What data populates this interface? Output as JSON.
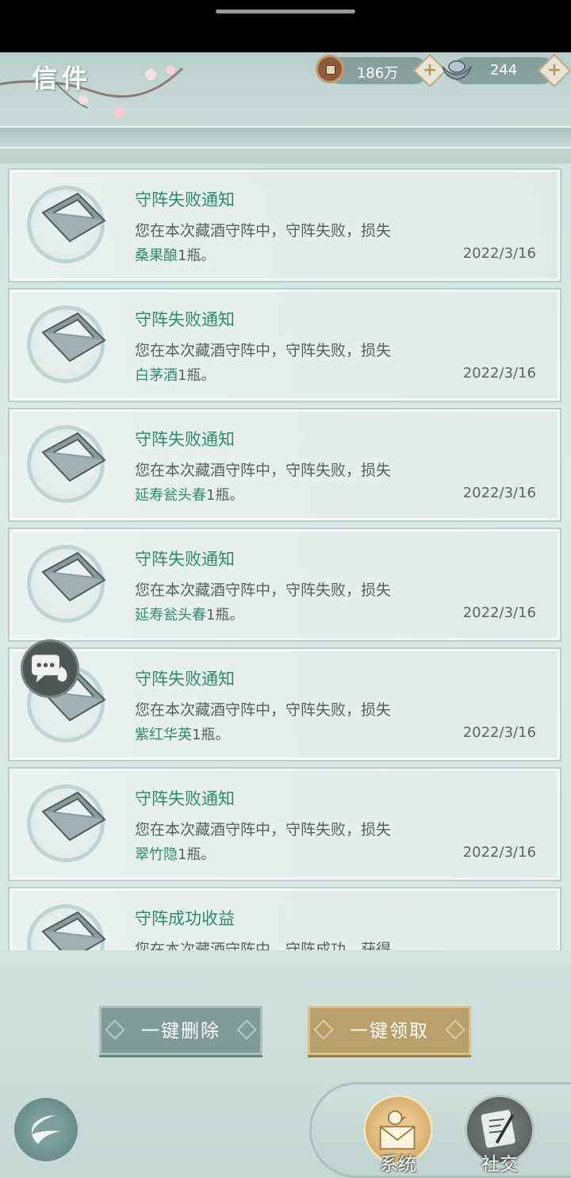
{
  "header": {
    "title": "信件",
    "copper": {
      "icon": "copper-coin-icon",
      "value": "186万",
      "add_label": "+"
    },
    "silver": {
      "icon": "silver-ingot-icon",
      "value": "244",
      "add_label": "+"
    }
  },
  "mails": [
    {
      "title": "守阵失败通知",
      "body": "您在本次藏酒守阵中，守阵失败，损失",
      "item": "桑果酿",
      "suffix": "1瓶。",
      "date": "2022/3/16"
    },
    {
      "title": "守阵失败通知",
      "body": "您在本次藏酒守阵中，守阵失败，损失",
      "item": "白茅酒",
      "suffix": "1瓶。",
      "date": "2022/3/16"
    },
    {
      "title": "守阵失败通知",
      "body": "您在本次藏酒守阵中，守阵失败，损失",
      "item": "延寿瓮头春",
      "suffix": "1瓶。",
      "date": "2022/3/16"
    },
    {
      "title": "守阵失败通知",
      "body": "您在本次藏酒守阵中，守阵失败，损失",
      "item": "延寿瓮头春",
      "suffix": "1瓶。",
      "date": "2022/3/16"
    },
    {
      "title": "守阵失败通知",
      "body": "您在本次藏酒守阵中，守阵失败，损失",
      "item": "紫红华英",
      "suffix": "1瓶。",
      "date": "2022/3/16"
    },
    {
      "title": "守阵失败通知",
      "body": "您在本次藏酒守阵中，守阵失败，损失",
      "item": "翠竹隐",
      "suffix": "1瓶。",
      "date": "2022/3/16"
    },
    {
      "title": "守阵成功收益",
      "body": "您在本次藏酒守阵中，守阵成功，获得",
      "item": "",
      "suffix": "",
      "date": ""
    }
  ],
  "actions": {
    "delete_all": "一键删除",
    "claim_all": "一键领取"
  },
  "tabs": {
    "system": "系统",
    "social": "社交"
  },
  "colors": {
    "accent_green": "#2e8b6e",
    "claim_gold": "#b9a06a",
    "delete_gray": "#7f9b98"
  }
}
